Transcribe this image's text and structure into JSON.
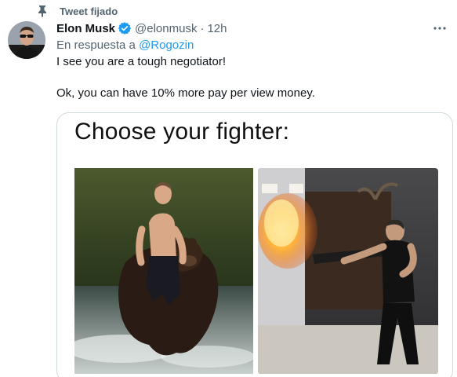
{
  "pinned": {
    "label": "Tweet fijado",
    "icon": "pin-icon"
  },
  "author": {
    "name": "Elon Musk",
    "handle": "@elonmusk",
    "separator": "·",
    "time": "12h",
    "verified": true,
    "avatar_icon": "avatar"
  },
  "reply": {
    "prefix": "En respuesta a",
    "mention": "@Rogozin"
  },
  "body": {
    "line1": "I see you are a tough negotiator!",
    "line2": "Ok, you can have 10% more pay per view money."
  },
  "media": {
    "meme_title": "Choose your fighter:"
  },
  "colors": {
    "accent": "#1d9bf0",
    "secondary_text": "#536471",
    "primary_text": "#0f1419",
    "border": "#cfd9de"
  }
}
